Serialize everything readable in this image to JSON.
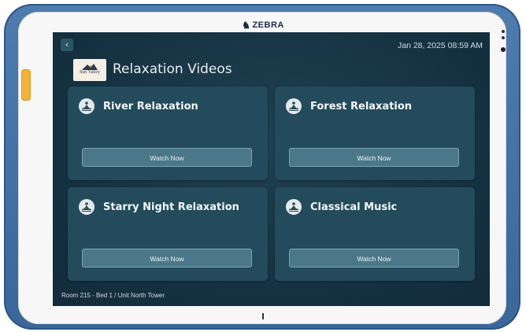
{
  "device": {
    "brand": "ZEBRA"
  },
  "header": {
    "back_icon": "chevron-left-icon",
    "datetime": "Jan 28, 2025  08:59 AM",
    "logo_text": "Sun Valley",
    "title": "Relaxation Videos"
  },
  "cards": [
    {
      "title": "River Relaxation",
      "button": "Watch Now",
      "icon": "meditation-icon"
    },
    {
      "title": "Forest Relaxation",
      "button": "Watch Now",
      "icon": "meditation-icon"
    },
    {
      "title": "Starry Night Relaxation",
      "button": "Watch Now",
      "icon": "meditation-icon"
    },
    {
      "title": "Classical Music",
      "button": "Watch Now",
      "icon": "meditation-icon"
    }
  ],
  "footer": {
    "location": "Room 215  -  Bed  1 / Unit North Tower"
  },
  "colors": {
    "screen_bg": "#163343",
    "card_bg": "#234b5b",
    "button_bg": "#4b7888",
    "device_frame": "#3b6699",
    "side_button": "#f1b33b"
  }
}
